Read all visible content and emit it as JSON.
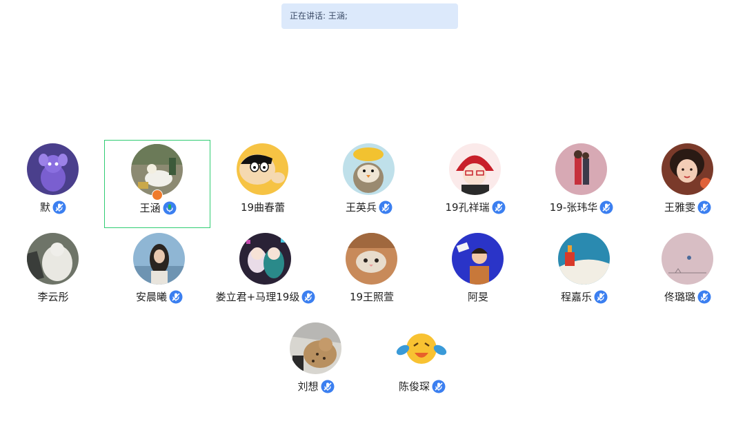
{
  "banner": {
    "text": "正在讲话: 王涵;"
  },
  "colors": {
    "active_border": "#2ecc71",
    "mic_muted": "#3b7ff0",
    "mic_active": "#21b35a",
    "host_badge": "#f07b2c",
    "banner_bg": "#dce9fb"
  },
  "participants": [
    {
      "name": "默",
      "mic": "muted-mic-icon",
      "active": false
    },
    {
      "name": "王涵",
      "mic": "active-mic-icon",
      "active": true,
      "host": true
    },
    {
      "name": "19曲春蕾",
      "mic": "none",
      "active": false
    },
    {
      "name": "王英兵",
      "mic": "muted-mic-icon",
      "active": false
    },
    {
      "name": "19孔祥瑞",
      "mic": "muted-mic-icon",
      "active": false
    },
    {
      "name": "19-张玮华",
      "mic": "muted-mic-icon",
      "active": false
    },
    {
      "name": "王雅雯",
      "mic": "muted-mic-icon",
      "active": false
    },
    {
      "name": "李云彤",
      "mic": "none",
      "active": false
    },
    {
      "name": "安晨曦",
      "mic": "muted-mic-icon",
      "active": false
    },
    {
      "name": "娄立君+马理19级",
      "mic": "muted-mic-icon",
      "active": false
    },
    {
      "name": "19王照萱",
      "mic": "none",
      "active": false
    },
    {
      "name": "阿旻",
      "mic": "none",
      "active": false
    },
    {
      "name": "程嘉乐",
      "mic": "muted-mic-icon",
      "active": false
    },
    {
      "name": "佟璐璐",
      "mic": "muted-mic-icon",
      "active": false
    },
    {
      "name": "刘想",
      "mic": "muted-mic-icon",
      "active": false
    },
    {
      "name": "陈俊琛",
      "mic": "muted-mic-icon",
      "active": false
    }
  ]
}
